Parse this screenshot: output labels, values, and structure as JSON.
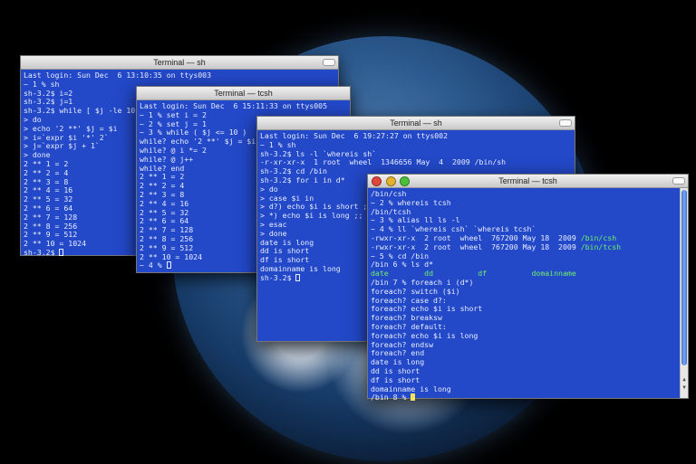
{
  "windows": [
    {
      "title": "Terminal — sh",
      "lines": [
        [
          "Last login: Sun Dec  6 13:10:35 on ttys003"
        ],
        [
          "~ 1 % sh"
        ],
        [
          "sh-3.2$ i=2"
        ],
        [
          "sh-3.2$ j=1"
        ],
        [
          "sh-3.2$ while [ $j -le 10 ]"
        ],
        [
          "> do"
        ],
        [
          "> echo '2 **' $j = $i"
        ],
        [
          "> i=`expr $i '*' 2`"
        ],
        [
          "> j=`expr $j + 1`"
        ],
        [
          "> done"
        ],
        [
          "2 ** 1 = 2"
        ],
        [
          "2 ** 2 = 4"
        ],
        [
          "2 ** 3 = 8"
        ],
        [
          "2 ** 4 = 16"
        ],
        [
          "2 ** 5 = 32"
        ],
        [
          "2 ** 6 = 64"
        ],
        [
          "2 ** 7 = 128"
        ],
        [
          "2 ** 8 = 256"
        ],
        [
          "2 ** 9 = 512"
        ],
        [
          "2 ** 10 = 1024"
        ],
        [
          "sh-3.2$ "
        ]
      ],
      "cursor_line": 20
    },
    {
      "title": "Terminal — tcsh",
      "lines": [
        [
          "Last login: Sun Dec  6 15:11:33 on ttys005"
        ],
        [
          "~ 1 % set i = 2"
        ],
        [
          "~ 2 % set j = 1"
        ],
        [
          "~ 3 % while ( $j <= 10 )"
        ],
        [
          "while? echo '2 **' $j = $i"
        ],
        [
          "while? @ i *= 2"
        ],
        [
          "while? @ j++"
        ],
        [
          "while? end"
        ],
        [
          "2 ** 1 = 2"
        ],
        [
          "2 ** 2 = 4"
        ],
        [
          "2 ** 3 = 8"
        ],
        [
          "2 ** 4 = 16"
        ],
        [
          "2 ** 5 = 32"
        ],
        [
          "2 ** 6 = 64"
        ],
        [
          "2 ** 7 = 128"
        ],
        [
          "2 ** 8 = 256"
        ],
        [
          "2 ** 9 = 512"
        ],
        [
          "2 ** 10 = 1024"
        ],
        [
          "~ 4 % "
        ]
      ],
      "cursor_line": 18
    },
    {
      "title": "Terminal — sh",
      "lines": [
        [
          "Last login: Sun Dec  6 19:27:27 on ttys002"
        ],
        [
          "~ 1 % sh"
        ],
        [
          "sh-3.2$ ls -l `whereis sh`"
        ],
        [
          "-r-xr-xr-x  1 root  wheel  1346656 May  4  2009 /bin/sh"
        ],
        [
          "sh-3.2$ cd /bin"
        ],
        [
          "sh-3.2$ for i in d*"
        ],
        [
          "> do"
        ],
        [
          "> case $i in"
        ],
        [
          "> d?) echo $i is short ;;"
        ],
        [
          "> *) echo $i is long ;;"
        ],
        [
          "> esac"
        ],
        [
          "> done"
        ],
        [
          "date is long"
        ],
        [
          "dd is short"
        ],
        [
          "df is short"
        ],
        [
          "domainname is long"
        ],
        [
          "sh-3.2$ "
        ]
      ],
      "cursor_line": 16
    },
    {
      "title": "Terminal — tcsh",
      "lines": [
        [
          "/bin/csh"
        ],
        [
          "~ 2 % whereis tcsh"
        ],
        [
          "/bin/tcsh"
        ],
        [
          "~ 3 % alias ll ls -l"
        ],
        [
          "~ 4 % ll `whereis csh` `whereis tcsh`"
        ],
        [
          "-rwxr-xr-x  2 root  wheel  767200 May 18  2009 ",
          "/bin/csh"
        ],
        [
          "-rwxr-xr-x  2 root  wheel  767200 May 18  2009 ",
          "/bin/tcsh"
        ],
        [
          "~ 5 % cd /bin"
        ],
        [
          "/bin 6 % ls d*"
        ],
        [
          "",
          "date        dd          df          domainname"
        ],
        [
          "/bin 7 % foreach i (d*)"
        ],
        [
          "foreach? switch ($i)"
        ],
        [
          "foreach? case d?:"
        ],
        [
          "foreach? echo $i is short"
        ],
        [
          "foreach? breaksw"
        ],
        [
          "foreach? default:"
        ],
        [
          "foreach? echo $i is long"
        ],
        [
          "foreach? endsw"
        ],
        [
          "foreach? end"
        ],
        [
          "date is long"
        ],
        [
          "dd is short"
        ],
        [
          "df is short"
        ],
        [
          "domainname is long"
        ],
        [
          "/bin 8 % "
        ]
      ],
      "cursor_line": 23
    }
  ],
  "colors": {
    "terminal_bg": "#2348c8",
    "terminal_text": "#e8eeff",
    "highlight_green": "#6ff06b",
    "cursor_yellow": "#f3e25a"
  }
}
